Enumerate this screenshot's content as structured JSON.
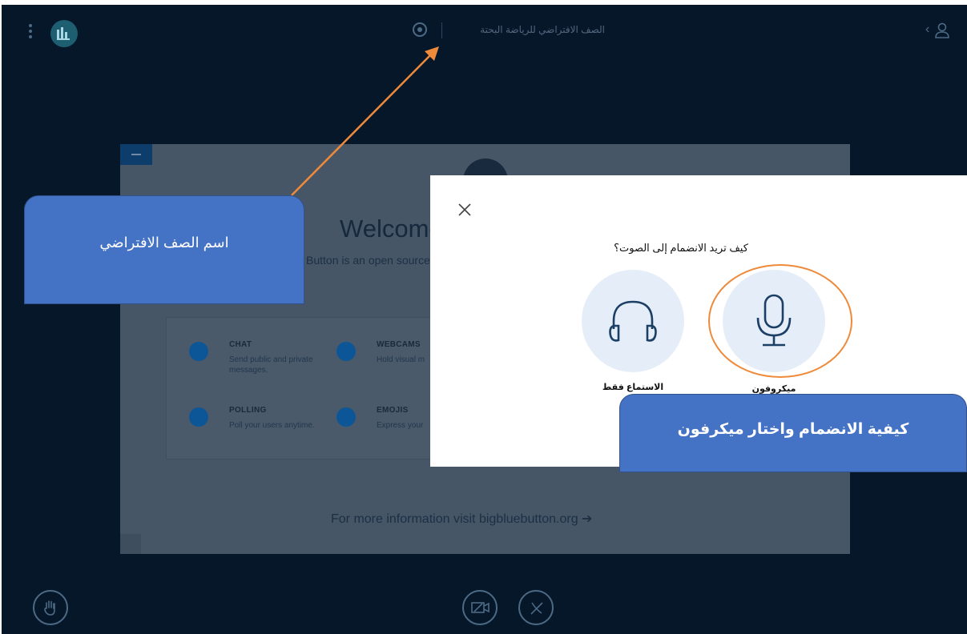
{
  "header": {
    "meeting_title": "الصف الافتراضي للرياضة البحتة"
  },
  "presentation": {
    "welcome_title": "Welcome",
    "welcome_subtitle": "Button is an open source",
    "features": [
      {
        "title": "CHAT",
        "description": "Send public and private messages.",
        "icon": "chat-icon"
      },
      {
        "title": "WEBCAMS",
        "description": "Hold visual m",
        "icon": "webcam-icon"
      },
      {
        "title": "POLLING",
        "description": "Poll your users anytime.",
        "icon": "polling-icon"
      },
      {
        "title": "EMOJIS",
        "description": "Express your",
        "icon": "hand-icon"
      }
    ],
    "more_info": "For more information visit bigbluebutton.org ➔"
  },
  "audio_modal": {
    "question": "كيف تريد الانضمام إلى الصوت؟",
    "option_listen_only": "الاستماع فقط",
    "option_microphone": "ميكروفون"
  },
  "annotations": {
    "class_name_callout": "اسم الصف الافتراضي",
    "join_callout": "كيفية الانضمام واختار ميكرفون"
  },
  "colors": {
    "background": "#06172a",
    "callout": "#4472c4",
    "arrow": "#ee8a3a",
    "accent": "#0c5698"
  }
}
